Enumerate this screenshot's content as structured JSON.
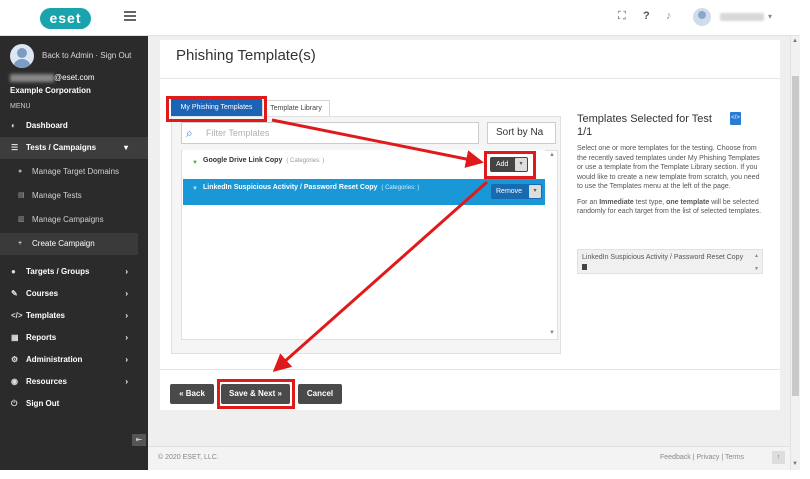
{
  "topbar": {
    "logo": "eset",
    "icons": [
      "fullscreen-icon",
      "help-icon",
      "bell-icon",
      "user-avatar"
    ]
  },
  "sidebar": {
    "back_link": "Back to Admin · Sign Out",
    "email_suffix": "@eset.com",
    "organization": "Example Corporation",
    "menu_label": "MENU",
    "items": {
      "dashboard": "Dashboard",
      "tests_campaigns": "Tests / Campaigns",
      "manage_target_domains": "Manage Target Domains",
      "manage_tests": "Manage Tests",
      "manage_campaigns": "Manage Campaigns",
      "create_campaign": "Create Campaign",
      "targets_groups": "Targets / Groups",
      "courses": "Courses",
      "templates": "Templates",
      "reports": "Reports",
      "administration": "Administration",
      "resources": "Resources",
      "sign_out": "Sign Out"
    }
  },
  "main": {
    "page_title": "Phishing Template(s)",
    "tabs": {
      "my_phishing_templates": "My Phishing Templates",
      "template_library": "Template Library"
    },
    "filter_placeholder": "Filter Templates",
    "sort_value": "Sort by Na",
    "templates": [
      {
        "name": "Google Drive Link Copy",
        "categories": "( Categories: )",
        "action": "Add",
        "selected": false
      },
      {
        "name": "LinkedIn Suspicious Activity / Password Reset Copy",
        "categories": "( Categories: )",
        "action": "Remove",
        "selected": true
      }
    ],
    "selected_panel": {
      "title": "Templates Selected for Test",
      "count": "1/1",
      "desc_1": "Select one or more templates for the testing. Choose from the recently saved templates under My Phishing Templates or use a template from the Template Library section. If you would like to create a new template from scratch, you need to use the Templates menu at the left of the page.",
      "desc_2_pre": "For an ",
      "desc_2_b1": "Immediate",
      "desc_2_mid": " test type, ",
      "desc_2_b2": "one template",
      "desc_2_post": " will be selected randomly for each target from the list of selected templates.",
      "selected_item": "LinkedIn Suspicious Activity / Password Reset Copy"
    },
    "buttons": {
      "back": "« Back",
      "save_next": "Save & Next »",
      "cancel": "Cancel"
    }
  },
  "footer": {
    "copyright": "© 2020 ESET, LLC.",
    "links": "Feedback | Privacy | Terms"
  },
  "annotation_color": "#e01a1a"
}
